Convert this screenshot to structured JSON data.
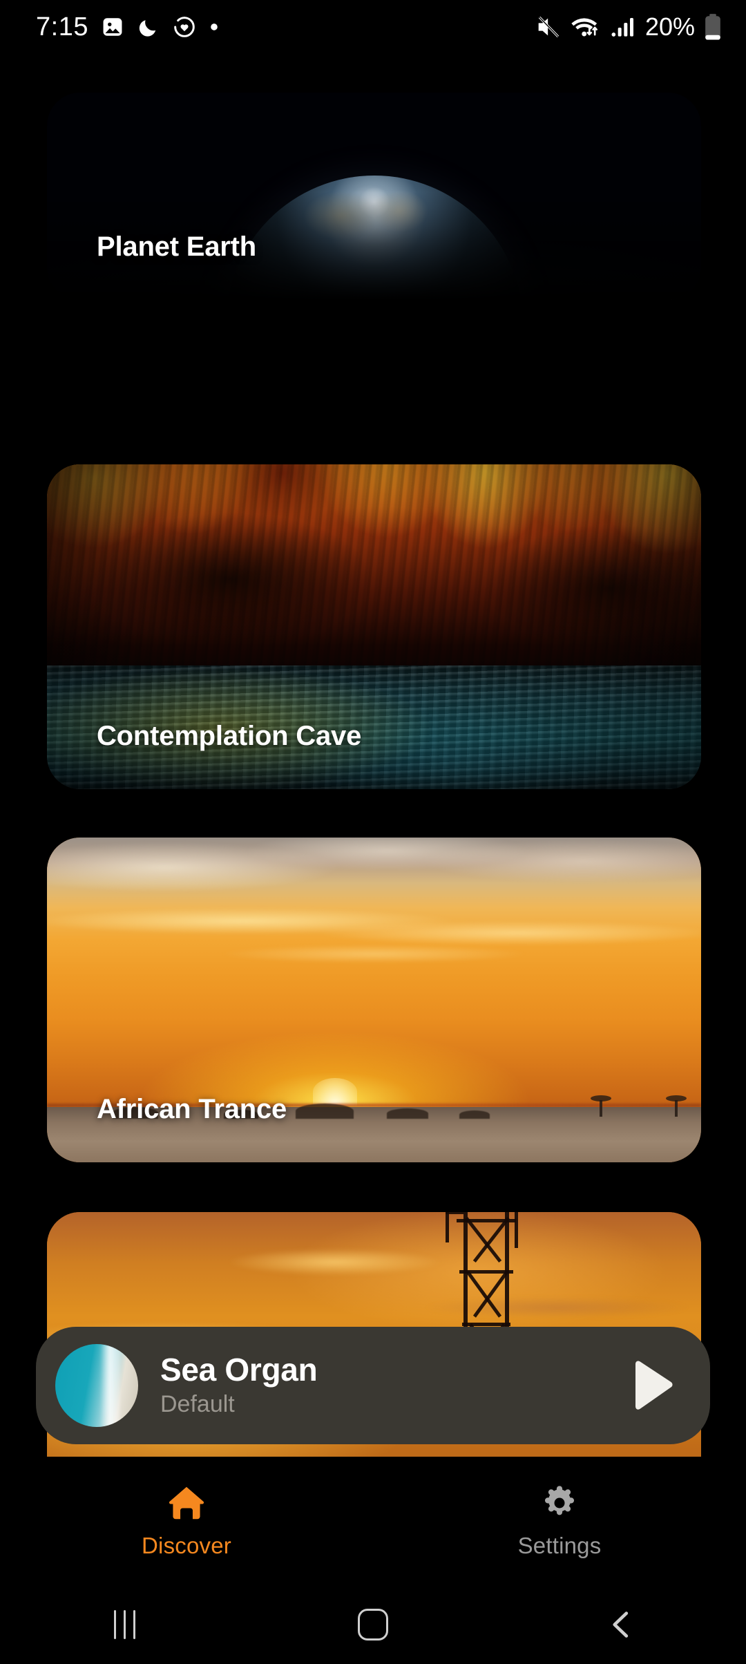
{
  "status_bar": {
    "time": "7:15",
    "battery_percent": "20%",
    "left_icons": [
      "gallery-image-icon",
      "do-not-disturb-moon-icon",
      "heart-health-icon",
      "dot-indicator-icon"
    ],
    "right_icons": [
      "mute-speaker-icon",
      "wifi-data-transfer-icon",
      "cellular-signal-icon",
      "battery-icon"
    ],
    "battery_level": 20
  },
  "cards": [
    {
      "title": "Planet Earth",
      "art": "earth-from-space"
    },
    {
      "title": "Contemplation Cave",
      "art": "red-cave-with-water"
    },
    {
      "title": "African Trance",
      "art": "savanna-golden-sunset"
    },
    {
      "title": "",
      "art": "sunset-sky-with-tower"
    }
  ],
  "player": {
    "title": "Sea Organ",
    "subtitle": "Default",
    "thumb": "aerial-ocean-shoreline",
    "play_icon": "play-icon"
  },
  "tabs": [
    {
      "label": "Discover",
      "icon": "home-icon",
      "active": true,
      "color": "#f5881f"
    },
    {
      "label": "Settings",
      "icon": "gear-icon",
      "active": false,
      "color": "#9a9a9a"
    }
  ],
  "nav_bar": {
    "recents": "recents-icon",
    "home": "home-square-icon",
    "back": "back-chevron-icon"
  },
  "theme": {
    "background": "#000000",
    "accent": "#f5881f",
    "player_bg": "#3a3832",
    "muted_text": "#9a9a9a"
  }
}
